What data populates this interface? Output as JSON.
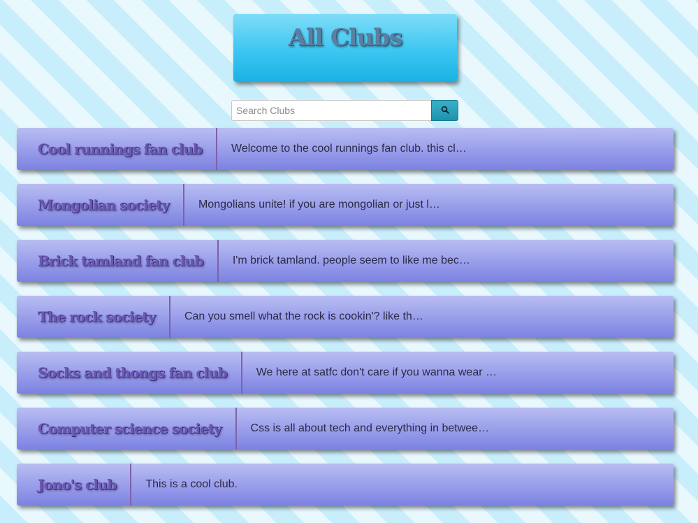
{
  "header": {
    "title": "All Clubs"
  },
  "search": {
    "placeholder": "Search Clubs",
    "value": "",
    "button_icon": "search-icon"
  },
  "clubs": [
    {
      "name": "Cool runnings fan club",
      "description": "Welcome to the cool runnings fan club. this cl…"
    },
    {
      "name": "Mongolian society",
      "description": "Mongolians unite! if you are mongolian or just l…"
    },
    {
      "name": "Brick tamland fan club",
      "description": "I'm brick tamland. people seem to like me bec…"
    },
    {
      "name": "The rock society",
      "description": "Can you smell what the rock is cookin'? like th…"
    },
    {
      "name": "Socks and thongs fan club",
      "description": "We here at satfc don't care if you wanna wear …"
    },
    {
      "name": "Computer science society",
      "description": "Css is all about tech and everything in betwee…"
    },
    {
      "name": "Jono's club",
      "description": "This is a cool club."
    }
  ],
  "colors": {
    "header_gradient_top": "#7fdcf8",
    "header_gradient_bottom": "#18b2e4",
    "card_gradient_top": "#b9bdf2",
    "card_gradient_bottom": "#7c82e2",
    "club_name_color": "#6b58b4",
    "search_button": "#1f93ad"
  }
}
